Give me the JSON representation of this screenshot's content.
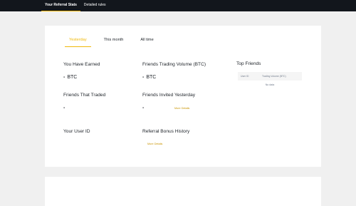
{
  "topnav": {
    "items": [
      {
        "label": "Your Referral Stats",
        "active": true
      },
      {
        "label": "Detailed rules",
        "active": false
      }
    ]
  },
  "tabs": [
    {
      "label": "Yesterday",
      "active": true
    },
    {
      "label": "This month",
      "active": false
    },
    {
      "label": "All time",
      "active": false
    }
  ],
  "stats": {
    "earned": {
      "label": "You Have Earned",
      "value": "-",
      "unit": "BTC"
    },
    "trading_volume": {
      "label": "Friends Trading Volume (BTC)",
      "value": "-",
      "unit": "BTC"
    },
    "friends_traded": {
      "label": "Friends That Traded",
      "value": "-"
    },
    "invited_yesterday": {
      "label": "Friends Invited Yesterday",
      "value": "-",
      "link": "More Details"
    },
    "user_id": {
      "label": "Your User ID"
    },
    "bonus_history": {
      "label": "Referral Bonus History",
      "link": "More Details"
    }
  },
  "top_friends": {
    "title": "Top Friends",
    "columns": [
      "User ID",
      "Trading Volume (BTC)"
    ],
    "empty": "No data"
  },
  "colors": {
    "accent": "#f0b90b",
    "topbar": "#12161c",
    "link": "#c99400"
  }
}
